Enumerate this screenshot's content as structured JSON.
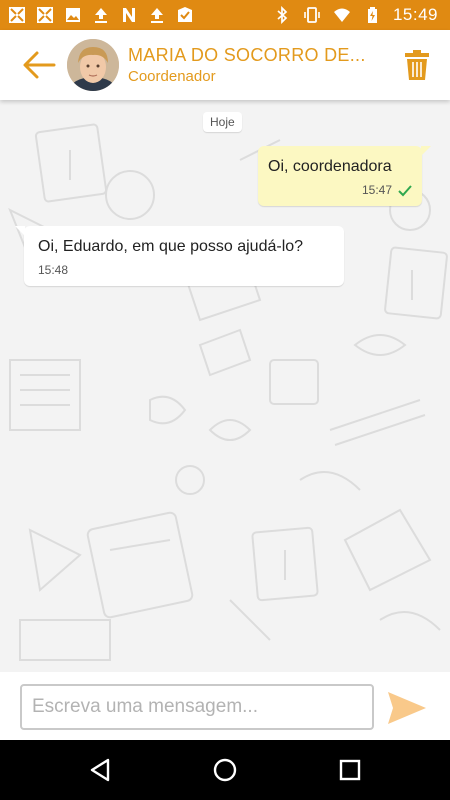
{
  "status_bar": {
    "time": "15:49",
    "background": "#e08a12",
    "left_icons": [
      "fullscreen-icon",
      "fullscreen-icon",
      "image-icon",
      "upload-icon",
      "n-app-icon",
      "upload-icon",
      "badge-check-icon"
    ],
    "right_icons": [
      "bluetooth-icon",
      "vibrate-icon",
      "wifi-icon",
      "battery-charging-icon"
    ]
  },
  "header": {
    "contact_name": "MARIA DO SOCORRO DE...",
    "contact_role": "Coordenador",
    "accent": "#e39a1d",
    "back_icon": "arrow-left-icon",
    "delete_icon": "trash-icon"
  },
  "chat": {
    "date_separator": "Hoje",
    "messages": [
      {
        "direction": "outgoing",
        "text": "Oi, coordenadora",
        "time": "15:47",
        "status_icon": "check-icon",
        "bubble_color": "#fcf8c2"
      },
      {
        "direction": "incoming",
        "text": "Oi, Eduardo, em que posso ajudá-lo?",
        "time": "15:48",
        "bubble_color": "#ffffff"
      }
    ]
  },
  "composer": {
    "placeholder": "Escreva uma mensagem...",
    "value": "",
    "send_icon": "send-icon",
    "send_color": "#f9c98a"
  },
  "nav_bar": {
    "buttons": [
      "back-triangle-icon",
      "home-circle-icon",
      "recents-square-icon"
    ]
  }
}
